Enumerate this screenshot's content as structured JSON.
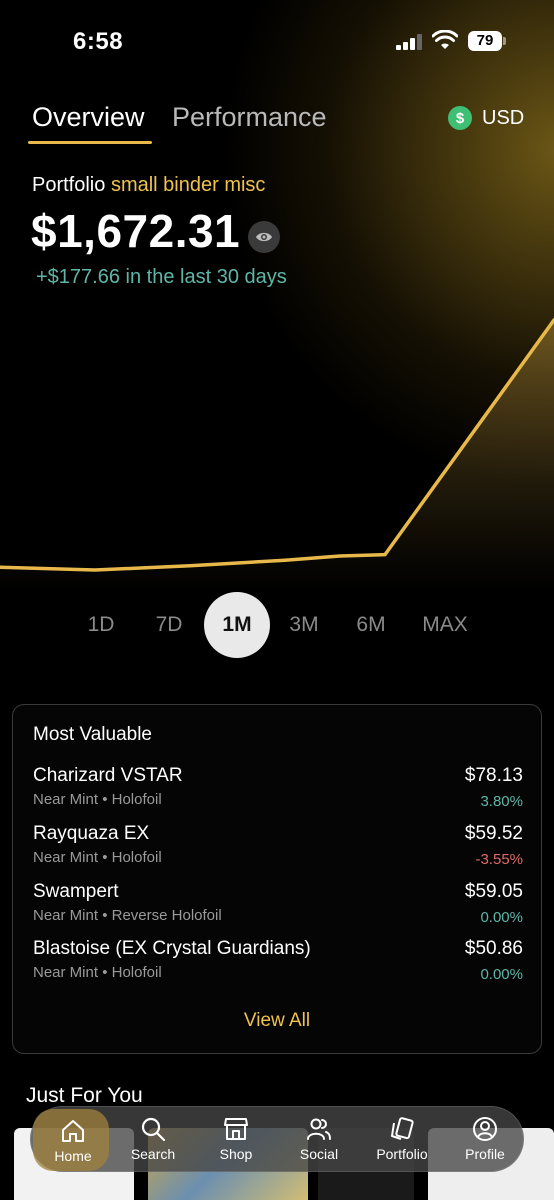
{
  "status_bar": {
    "time": "6:58",
    "battery": "79"
  },
  "tabs": [
    {
      "label": "Overview",
      "active": true
    },
    {
      "label": "Performance",
      "active": false
    }
  ],
  "currency": {
    "icon": "$",
    "label": "USD"
  },
  "portfolio": {
    "prefix": "Portfolio",
    "name": "small binder misc",
    "value": "$1,672.31",
    "change": "+$177.66 in the last 30 days"
  },
  "chart_data": {
    "type": "area",
    "series": [
      {
        "values": [
          1495,
          1493,
          1496,
          1500,
          1503,
          1504,
          1672
        ]
      }
    ],
    "title": "",
    "xlabel": "",
    "ylabel": "",
    "grid": false,
    "color": "#e8b84a"
  },
  "ranges": [
    {
      "label": "1D",
      "active": false
    },
    {
      "label": "7D",
      "active": false
    },
    {
      "label": "1M",
      "active": true
    },
    {
      "label": "3M",
      "active": false
    },
    {
      "label": "6M",
      "active": false
    },
    {
      "label": "MAX",
      "active": false
    }
  ],
  "most_valuable": {
    "title": "Most Valuable",
    "items": [
      {
        "name": "Charizard VSTAR",
        "condition": "Near Mint",
        "finish": "Holofoil",
        "price": "$78.13",
        "change": "3.80%",
        "trend": "up"
      },
      {
        "name": "Rayquaza EX",
        "condition": "Near Mint",
        "finish": "Holofoil",
        "price": "$59.52",
        "change": "-3.55%",
        "trend": "down"
      },
      {
        "name": "Swampert",
        "condition": "Near Mint",
        "finish": "Reverse Holofoil",
        "price": "$59.05",
        "change": "0.00%",
        "trend": "flat"
      },
      {
        "name": "Blastoise (EX Crystal Guardians)",
        "condition": "Near Mint",
        "finish": "Holofoil",
        "price": "$50.86",
        "change": "0.00%",
        "trend": "flat"
      }
    ],
    "view_all": "View All"
  },
  "just_for_you": {
    "title": "Just For You"
  },
  "nav": [
    {
      "label": "Home",
      "icon": "home-icon",
      "active": true
    },
    {
      "label": "Search",
      "icon": "search-icon",
      "active": false
    },
    {
      "label": "Shop",
      "icon": "shop-icon",
      "active": false
    },
    {
      "label": "Social",
      "icon": "social-icon",
      "active": false
    },
    {
      "label": "Portfolio",
      "icon": "cards-icon",
      "active": false
    },
    {
      "label": "Profile",
      "icon": "profile-icon",
      "active": false
    }
  ],
  "colors": {
    "accent": "#e8b84a",
    "positive": "#5fb6a8",
    "negative": "#e26a6a",
    "usd": "#3fbf73"
  }
}
